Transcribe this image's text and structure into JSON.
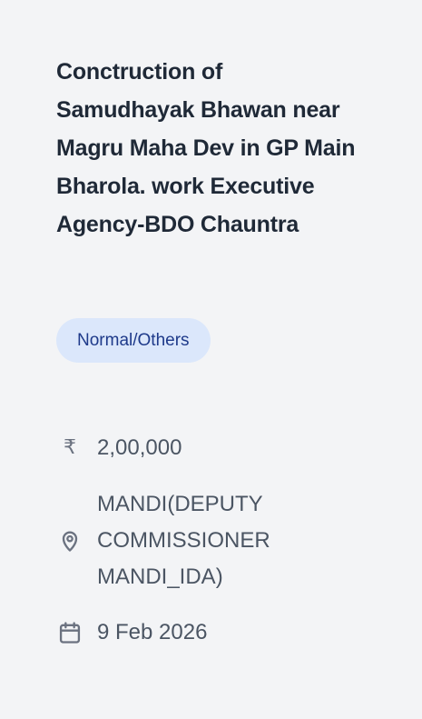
{
  "work": {
    "title": "Conctruction of Samudhayak Bhawan near Magru Maha Dev in GP Main Bharola. work Executive Agency-BDO Chauntra",
    "category_badge": "Normal/Others",
    "amount": {
      "icon": "rupee-icon",
      "symbol": "₹",
      "value": "2,00,000"
    },
    "location": {
      "icon": "map-pin-icon",
      "value": "MANDI(DEPUTY\nCOMMISSIONER\nMANDI_IDA)"
    },
    "date": {
      "icon": "calendar-icon",
      "value": "9 Feb 2026"
    }
  },
  "colors": {
    "background": "#f3f4f6",
    "title": "#1f2937",
    "badge_background": "#dbe7fb",
    "badge_text": "#1e3a8a",
    "meta_text": "#4b5563",
    "icon": "#6b7280"
  }
}
